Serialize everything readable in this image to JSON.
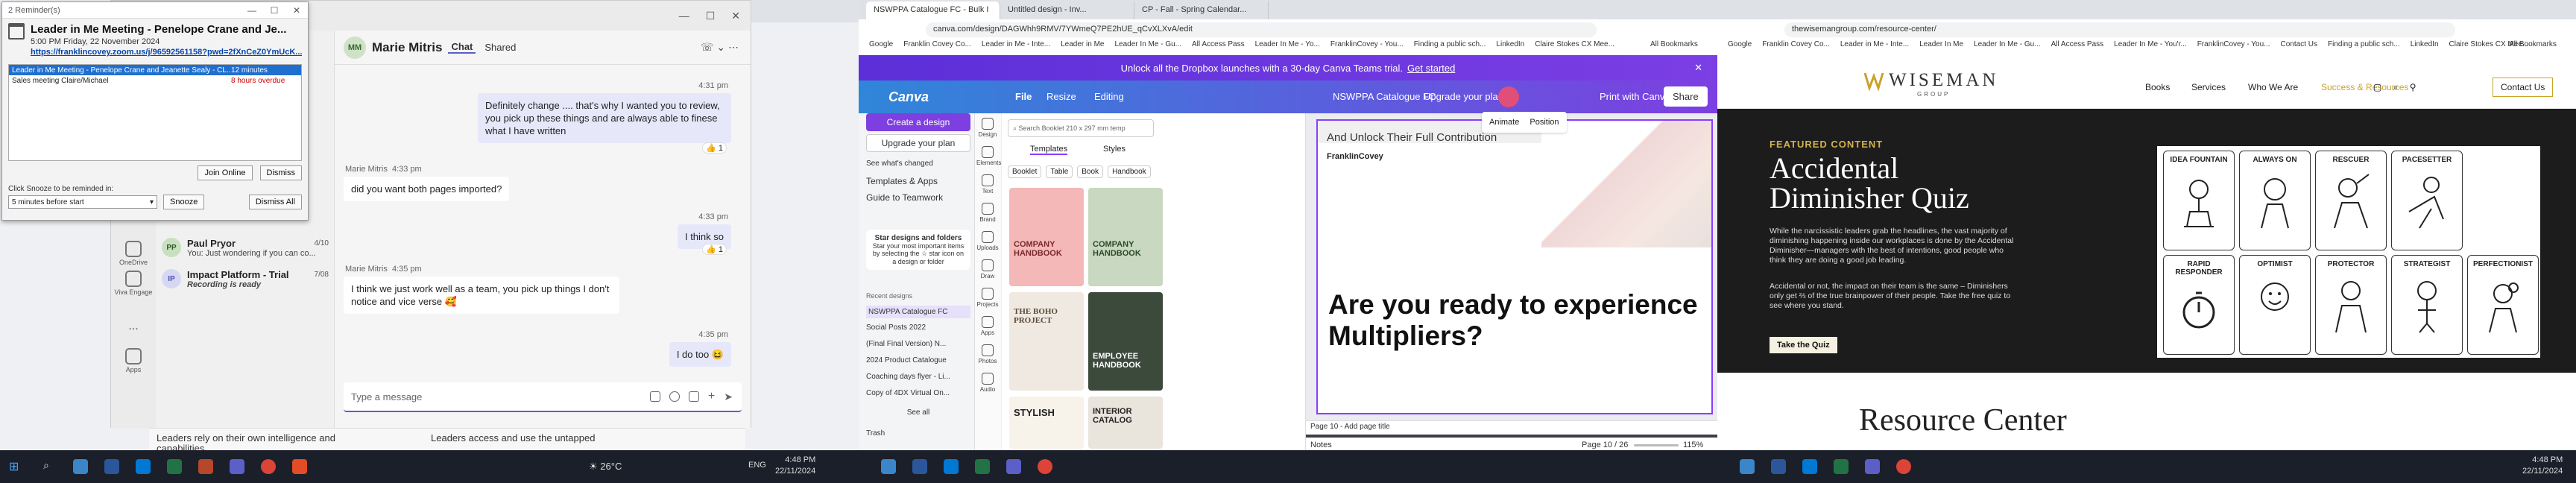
{
  "reminder": {
    "window_title": "2 Reminder(s)",
    "subject": "Leader in Me Meeting - Penelope Crane and Je...",
    "time": "5:00 PM Friday, 22 November 2024",
    "link": "https://franklincovey.zoom.us/j/96592561158?pwd=2fXnCeZ0YmUcK...",
    "items": [
      {
        "title": "Leader in Me Meeting - Penelope Crane and Jeanette Sealy - CL...",
        "due": "12 minutes"
      },
      {
        "title": "Sales meeting Claire/Michael",
        "due": "8 hours overdue"
      }
    ],
    "join_label": "Join Online",
    "dismiss_label": "Dismiss",
    "snooze_prompt": "Click Snooze to be reminded in:",
    "snooze_value": "5 minutes before start",
    "snooze_label": "Snooze",
    "dismiss_all_label": "Dismiss All"
  },
  "teams": {
    "rail": [
      {
        "label": "OneDrive"
      },
      {
        "label": "Viva Engage"
      },
      {
        "label": "..."
      },
      {
        "label": "Apps"
      }
    ],
    "list": [
      {
        "initials": "PP",
        "name": "Paul Pryor",
        "preview": "You: Just wondering if you can co...",
        "date": "4/10"
      },
      {
        "initials": "IP",
        "name": "Impact Platform - Trial",
        "preview": "Recording is ready",
        "date": "7/08"
      }
    ],
    "chat_initials": "MM",
    "chat_name": "Marie Mitris",
    "tabs": [
      "Chat",
      "Shared"
    ],
    "messages": [
      {
        "dir": "out",
        "time": "4:31 pm",
        "text": "Definitely change .... that's why I wanted you to review, you pick up these things and are always able to finese what I have written"
      },
      {
        "dir": "in",
        "sender": "Marie Mitris",
        "time": "4:33 pm",
        "text": "did you want both pages imported?"
      },
      {
        "dir": "out",
        "time": "4:33 pm",
        "text": "I think so"
      },
      {
        "dir": "in",
        "sender": "Marie Mitris",
        "time": "4:35 pm",
        "text": "I think we just work well as a team, you pick up things I don't notice and vice verse 🥰"
      },
      {
        "dir": "out",
        "time": "4:35 pm",
        "text": "I do too 😆"
      }
    ],
    "reactions": [
      "👍 1",
      "👍 1"
    ],
    "compose_placeholder": "Type a message"
  },
  "m1_bg": {
    "strip_left": "Leaders rely on their own intelligence and capabilities",
    "strip_right": "Leaders access and use the untapped"
  },
  "taskbar1": {
    "weather": "26°C",
    "lang": "ENG",
    "time": "4:48 PM",
    "date": "22/11/2024"
  },
  "canva": {
    "tabs": [
      "NSWPPA Catalogue FC - Bulk I",
      "Untitled design - Inv...",
      "CP - Fall - Spring Calendar..."
    ],
    "url": "canva.com/design/DAGWhh9RMV/7YWmeQ7PE2hUE_qCvXLXvA/edit",
    "bookmarks": [
      "Google",
      "Franklin Covey Co...",
      "Leader in Me - Inte...",
      "Leader in Me",
      "Leader In Me - Gu...",
      "All Access Pass",
      "Leader In Me - Yo...",
      "FranklinCovey - You...",
      "Finding a public sch...",
      "LinkedIn",
      "Claire Stokes CX Mee..."
    ],
    "bookmarks_right": "All Bookmarks",
    "banner": "Unlock all the Dropbox launches with a 30-day Canva Teams trial.",
    "banner_link": "Get started",
    "brand": "Canva",
    "menu": [
      "File",
      "Resize",
      "Editing"
    ],
    "doc_title": "NSWPPA Catalogue FC",
    "upgrade": "Upgrade your plan",
    "print_label": "Print with Canva",
    "share_label": "Share",
    "create_label": "Create a design",
    "upgrade_left": "Upgrade your plan",
    "left_items": [
      "See what's changed",
      "Templates & Apps",
      "Guide to Teamwork"
    ],
    "star_title": "Star designs and folders",
    "star_text": "Star your most important items by selecting the ☆ star icon on a design or folder",
    "recent_label": "Recent designs",
    "recent": [
      "NSWPPA Catalogue FC",
      "Social Posts 2022",
      "(Final Final Version) N...",
      "2024 Product Catalogue",
      "Coaching days flyer - Li...",
      "Copy of 4DX Virtual On..."
    ],
    "see_all": "See all",
    "trash": "Trash",
    "side": [
      "Design",
      "Elements",
      "Text",
      "Brand",
      "Uploads",
      "Draw",
      "Projects",
      "Apps",
      "Photos",
      "Audio"
    ],
    "search_placeholder": "Search Booklet 210 x 297 mm temp",
    "panel_tabs": [
      "Templates",
      "Styles"
    ],
    "chips": [
      "Booklet",
      "Table",
      "Book",
      "Handbook"
    ],
    "templates": [
      "COMPANY HANDBOOK",
      "COMPANY HANDBOOK",
      "THE BOHO PROJECT",
      "EMPLOYEE HANDBOOK",
      "STYLISH",
      "INTERIOR CATALOG"
    ],
    "toolbar": [
      "Animate",
      "Position"
    ],
    "slide_sub": "And Unlock Their Full Contribution",
    "slide_brand": "FranklinCovey",
    "slide_big": "Are you ready to experience Multipliers?",
    "page_label": "Page 10 - Add page title",
    "notes": "Notes",
    "page_count": "Page 10 / 26",
    "zoom": "115%"
  },
  "wiseman": {
    "url": "thewisemangroup.com/resource-center/",
    "bookmarks": [
      "Google",
      "Franklin Covey Co...",
      "Leader in Me - Inte...",
      "Leader In Me",
      "Leader In Me - Gu...",
      "All Access Pass",
      "Leader In Me - You'r...",
      "FranklinCovey - You...",
      "Contact Us",
      "Finding a public sch...",
      "LinkedIn",
      "Claire Stokes CX Mee..."
    ],
    "bookmarks_right": "All Bookmarks",
    "logo": "WISEMAN",
    "logo_sub": "GROUP",
    "menu": [
      "Books",
      "Services",
      "Who We Are",
      "Success & Resources"
    ],
    "contact": "Contact Us",
    "featured": "FEATURED CONTENT",
    "title_line1": "Accidental",
    "title_line2": "Diminisher Quiz",
    "p1": "While the narcissistic leaders grab the headlines, the vast majority of diminishing happening inside our workplaces is done by the Accidental Diminisher—managers with the best of intentions, good people who think they are doing a good job leading.",
    "p2": "Accidental or not, the impact on their team is the same – Diminishers only get ⅔ of the true brainpower of their people. Take the free quiz to see where you stand.",
    "quiz_btn": "Take the Quiz",
    "cards": [
      "IDEA FOUNTAIN",
      "ALWAYS ON",
      "RESCUER",
      "PACESETTER",
      "RAPID RESPONDER",
      "OPTIMIST",
      "PROTECTOR",
      "STRATEGIST",
      "PERFECTIONIST"
    ],
    "resource": "Resource Center"
  },
  "taskbar3": {
    "time": "4:48 PM",
    "date": "22/11/2024"
  },
  "colors": {
    "teams_purple": "#5b5fc7",
    "canva_purple": "#8b3dff",
    "wiseman_gold": "#c9a227",
    "reminder_select": "#1f6fd0"
  }
}
